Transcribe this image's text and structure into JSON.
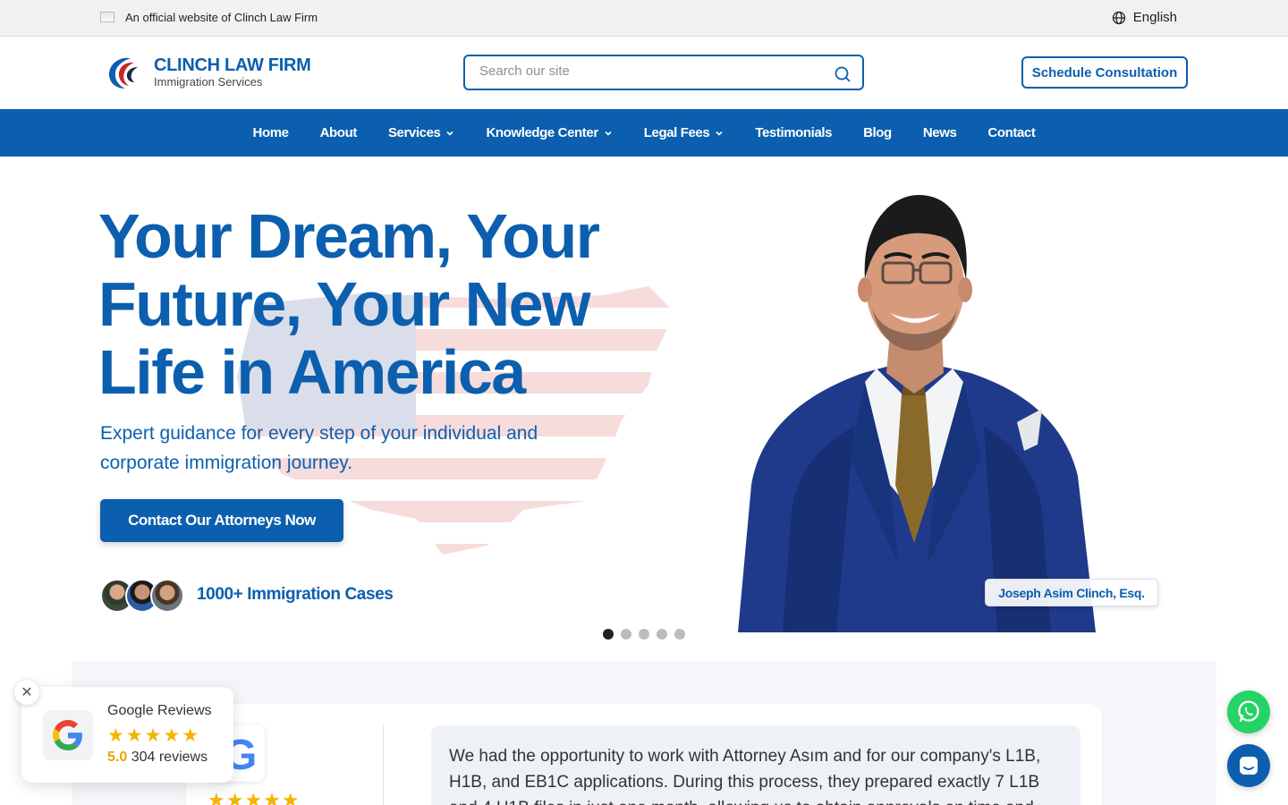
{
  "topbar": {
    "official_text": "An official website of Clinch Law Firm",
    "language": "English",
    "icons": [
      "flag-icon",
      "globe-icon"
    ]
  },
  "header": {
    "logo_name": "CLINCH LAW FIRM",
    "logo_subtitle": "Immigration Services",
    "search_placeholder": "Search our site",
    "schedule_label": "Schedule Consultation",
    "icons": [
      "logo-eagle-icon",
      "search-icon"
    ]
  },
  "nav": {
    "items": [
      {
        "label": "Home",
        "dropdown": false
      },
      {
        "label": "About",
        "dropdown": false
      },
      {
        "label": "Services",
        "dropdown": true
      },
      {
        "label": "Knowledge Center",
        "dropdown": true
      },
      {
        "label": "Legal Fees",
        "dropdown": true
      },
      {
        "label": "Testimonials",
        "dropdown": false
      },
      {
        "label": "Blog",
        "dropdown": false
      },
      {
        "label": "News",
        "dropdown": false
      },
      {
        "label": "Contact",
        "dropdown": false
      }
    ]
  },
  "hero": {
    "title": "Your Dream, Your Future, Your New Life in America",
    "subtitle": "Expert guidance for every step of your individual and corporate immigration journey.",
    "cta_label": "Contact Our Attorneys Now",
    "cases_label": "1000+ Immigration Cases",
    "attorney_name": "Joseph Asim Clinch, Esq.",
    "slides_total": 5,
    "active_slide": 1
  },
  "reviews": {
    "badge_title": "Google Reviews",
    "stars": "★★★★★",
    "rating": "5.0",
    "count_label": "304 reviews",
    "quote": "We had the opportunity to work with Attorney Asım and for our company's L1B, H1B, and EB1C applications. During this process, they prepared exactly 7 L1B and 4 H1B files in just one month, allowing us to obtain approvals on time and"
  },
  "colors": {
    "brand_blue": "#0b5fae",
    "star_gold": "#f5b400",
    "whatsapp_green": "#25d366"
  }
}
